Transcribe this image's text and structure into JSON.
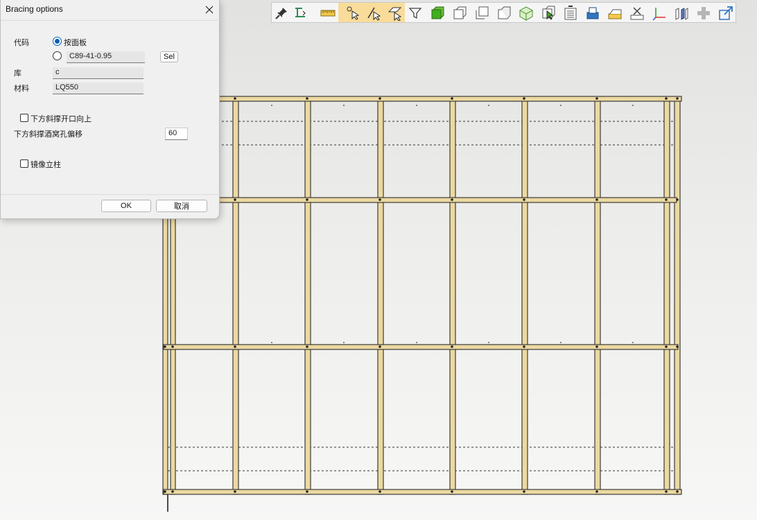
{
  "dialog": {
    "title": "Bracing options",
    "code_label": "代码",
    "option_panel_label": "按面板",
    "option_profile_value": "C89-41-0.95",
    "sel_button": "Sel",
    "library_label": "库",
    "library_value": "c",
    "material_label": "材料",
    "material_value": "LQ550",
    "lower_brace_open_up_label": "下方斜撑开口向上",
    "lower_brace_hole_offset_label": "下方斜撑酒窝孔偏移",
    "lower_brace_hole_offset_value": "60",
    "mirror_studs_label": "镜像立柱",
    "ok_button": "OK",
    "cancel_button": "取消",
    "selected_code_option": "panel",
    "lower_brace_open_up_checked": false,
    "mirror_studs_checked": false
  },
  "toolbar": {
    "icons": [
      "pin-icon",
      "align-icon",
      "ruler-icon",
      "select-point-icon",
      "select-edge-icon",
      "select-face-icon",
      "filter-icon",
      "view-front-green-icon",
      "view-top-icon",
      "view-side-icon",
      "view-back-icon",
      "view-iso-icon",
      "view-select-icon",
      "list-icon",
      "stack-icon",
      "layers-icon",
      "clear-icon",
      "axes-icon",
      "columns-icon",
      "plus-icon",
      "export-icon"
    ],
    "highlighted": [
      "select-point-icon",
      "select-edge-icon",
      "select-face-icon"
    ]
  },
  "colors": {
    "member_fill": "#ecd9a0",
    "member_stroke": "#3a3a3a",
    "dialog_bg": "#f0f0f0",
    "toolbar_highlight": "#f9dc9a",
    "radio_accent": "#005fb8"
  }
}
